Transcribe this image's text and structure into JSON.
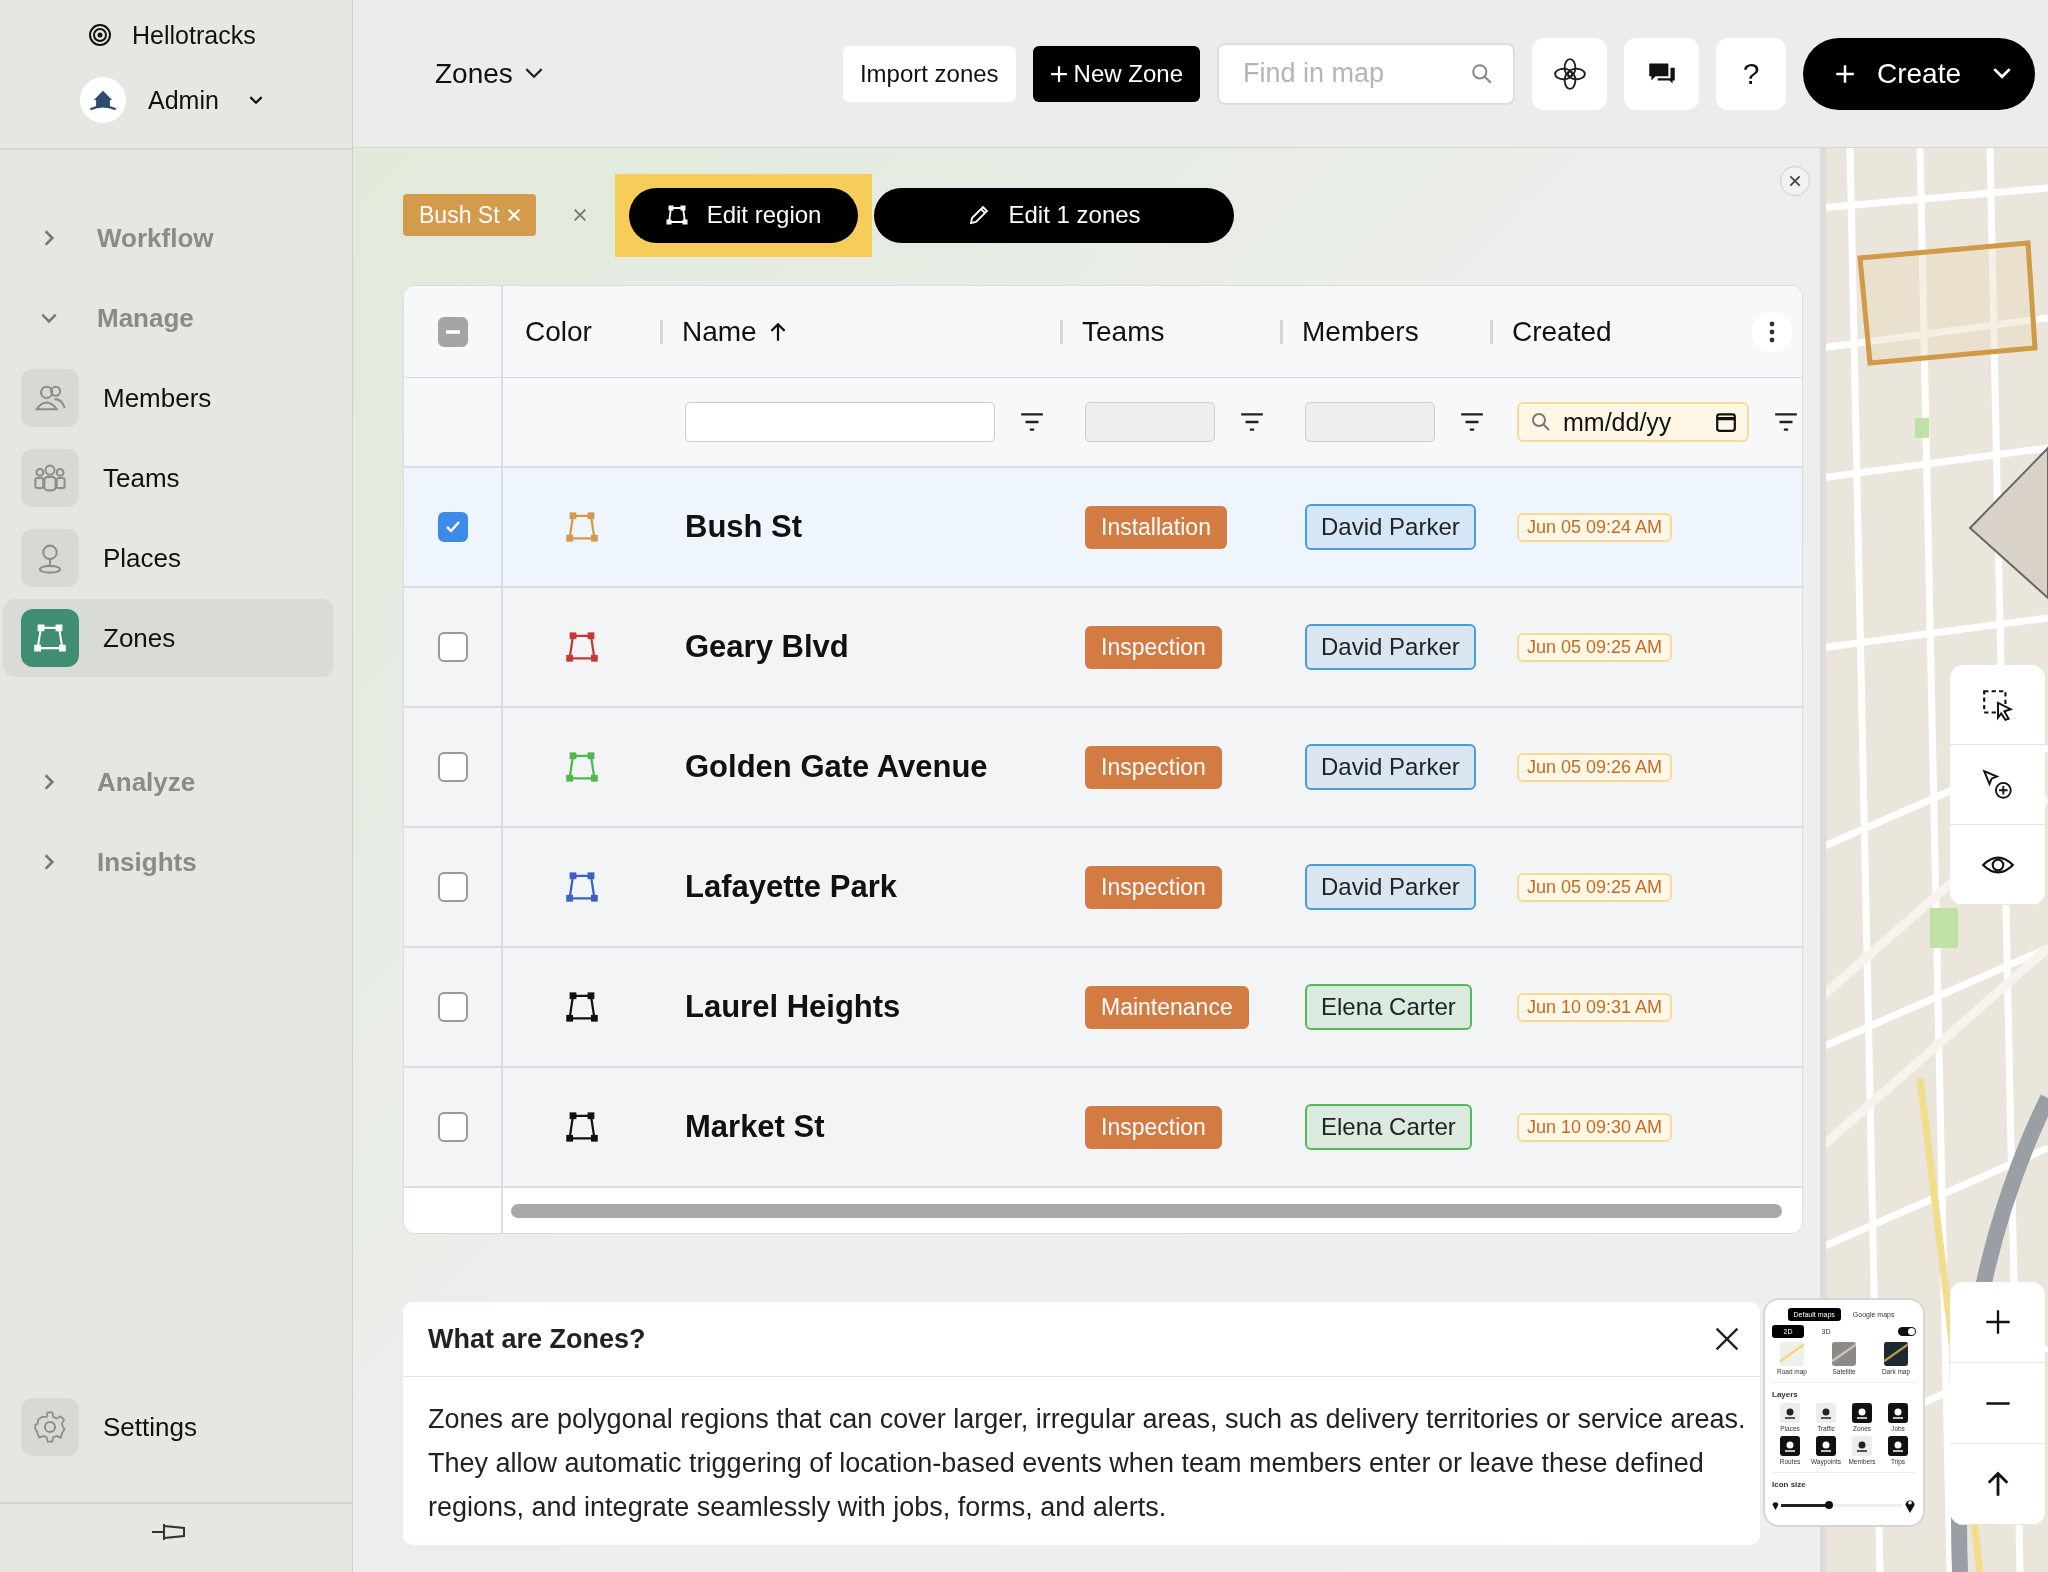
{
  "sidebar": {
    "brand": "Hellotracks",
    "account": "Admin",
    "nav": [
      {
        "label": "Workflow",
        "expanded": false
      },
      {
        "label": "Manage",
        "expanded": true,
        "children": [
          {
            "label": "Members",
            "selected": false
          },
          {
            "label": "Teams",
            "selected": false
          },
          {
            "label": "Places",
            "selected": false
          },
          {
            "label": "Zones",
            "selected": true
          }
        ]
      },
      {
        "label": "Analyze",
        "expanded": false
      },
      {
        "label": "Insights",
        "expanded": false
      }
    ],
    "settings": "Settings"
  },
  "header": {
    "title": "Zones",
    "import_button": "Import zones",
    "new_button": "New Zone",
    "search": {
      "placeholder": "Find in map"
    },
    "help": "?",
    "create": "Create"
  },
  "selection": {
    "chips": [
      {
        "label": "Bush St"
      }
    ],
    "actions": [
      {
        "kind": "region",
        "label": "Edit region",
        "highlighted": true
      },
      {
        "kind": "zones",
        "label": "Edit 1 zones",
        "highlighted": false
      }
    ]
  },
  "table": {
    "select_all": {
      "indeterminate": true
    },
    "columns": [
      {
        "label": "Color",
        "sorted": false
      },
      {
        "label": "Name",
        "sorted": true,
        "filter": {
          "kind": "text"
        }
      },
      {
        "label": "Teams",
        "sorted": false,
        "filter": {
          "kind": "disabled"
        }
      },
      {
        "label": "Members",
        "sorted": false,
        "filter": {
          "kind": "disabled"
        }
      },
      {
        "label": "Created",
        "sorted": false,
        "filter": {
          "kind": "date",
          "placeholder": "mm/dd/yy"
        }
      }
    ],
    "rows": [
      {
        "checked": true,
        "color": "#d49a4c",
        "name": "Bush St",
        "team": "Installation",
        "member": {
          "name": "David Parker",
          "color": "#4a9ad8"
        },
        "created": "Jun 05 09:24 AM"
      },
      {
        "checked": false,
        "color": "#c43a30",
        "name": "Geary Blvd",
        "team": "Inspection",
        "member": {
          "name": "David Parker",
          "color": "#4a9ad8"
        },
        "created": "Jun 05 09:25 AM"
      },
      {
        "checked": false,
        "color": "#4fb84a",
        "name": "Golden Gate Avenue",
        "team": "Inspection",
        "member": {
          "name": "David Parker",
          "color": "#4a9ad8"
        },
        "created": "Jun 05 09:26 AM"
      },
      {
        "checked": false,
        "color": "#3c5fc8",
        "name": "Lafayette Park",
        "team": "Inspection",
        "member": {
          "name": "David Parker",
          "color": "#4a9ad8"
        },
        "created": "Jun 05 09:25 AM"
      },
      {
        "checked": false,
        "color": "#111111",
        "name": "Laurel Heights",
        "team": "Maintenance",
        "member": {
          "name": "Elena Carter",
          "color": "#55b85a"
        },
        "created": "Jun 10 09:31 AM"
      },
      {
        "checked": false,
        "color": "#111111",
        "name": "Market St",
        "team": "Inspection",
        "member": {
          "name": "Elena Carter",
          "color": "#55b85a"
        },
        "created": "Jun 10 09:30 AM"
      }
    ]
  },
  "info": {
    "title": "What are Zones?",
    "text": "Zones are polygonal regions that can cover larger, irregular areas, such as delivery territories or service areas. They allow automatic triggering of location-based events when team members enter or leave these defined regions, and integrate seamlessly with jobs, forms, and alerts."
  },
  "map": {
    "kind": "picture",
    "layers_panel": {
      "sources": [
        {
          "label": "Default maps",
          "selected": true
        },
        {
          "label": "Google maps",
          "selected": false
        }
      ],
      "modes": [
        {
          "label": "2D",
          "selected": true
        },
        {
          "label": "3D",
          "selected": false
        }
      ],
      "switch_on": true,
      "base_maps": [
        {
          "label": "Road map"
        },
        {
          "label": "Satellite"
        },
        {
          "label": "Dark map"
        }
      ],
      "layers_title": "Layers",
      "layers": [
        {
          "label": "Places",
          "on": false
        },
        {
          "label": "Traffic",
          "on": false
        },
        {
          "label": "Zones",
          "on": true
        },
        {
          "label": "Jobs",
          "on": true
        },
        {
          "label": "Routes",
          "on": true
        },
        {
          "label": "Waypoints",
          "on": true
        },
        {
          "label": "Members",
          "on": false
        },
        {
          "label": "Trips",
          "on": true
        }
      ],
      "icon_size_title": "Icon size",
      "icon_size": {
        "level": 0.4
      }
    }
  }
}
